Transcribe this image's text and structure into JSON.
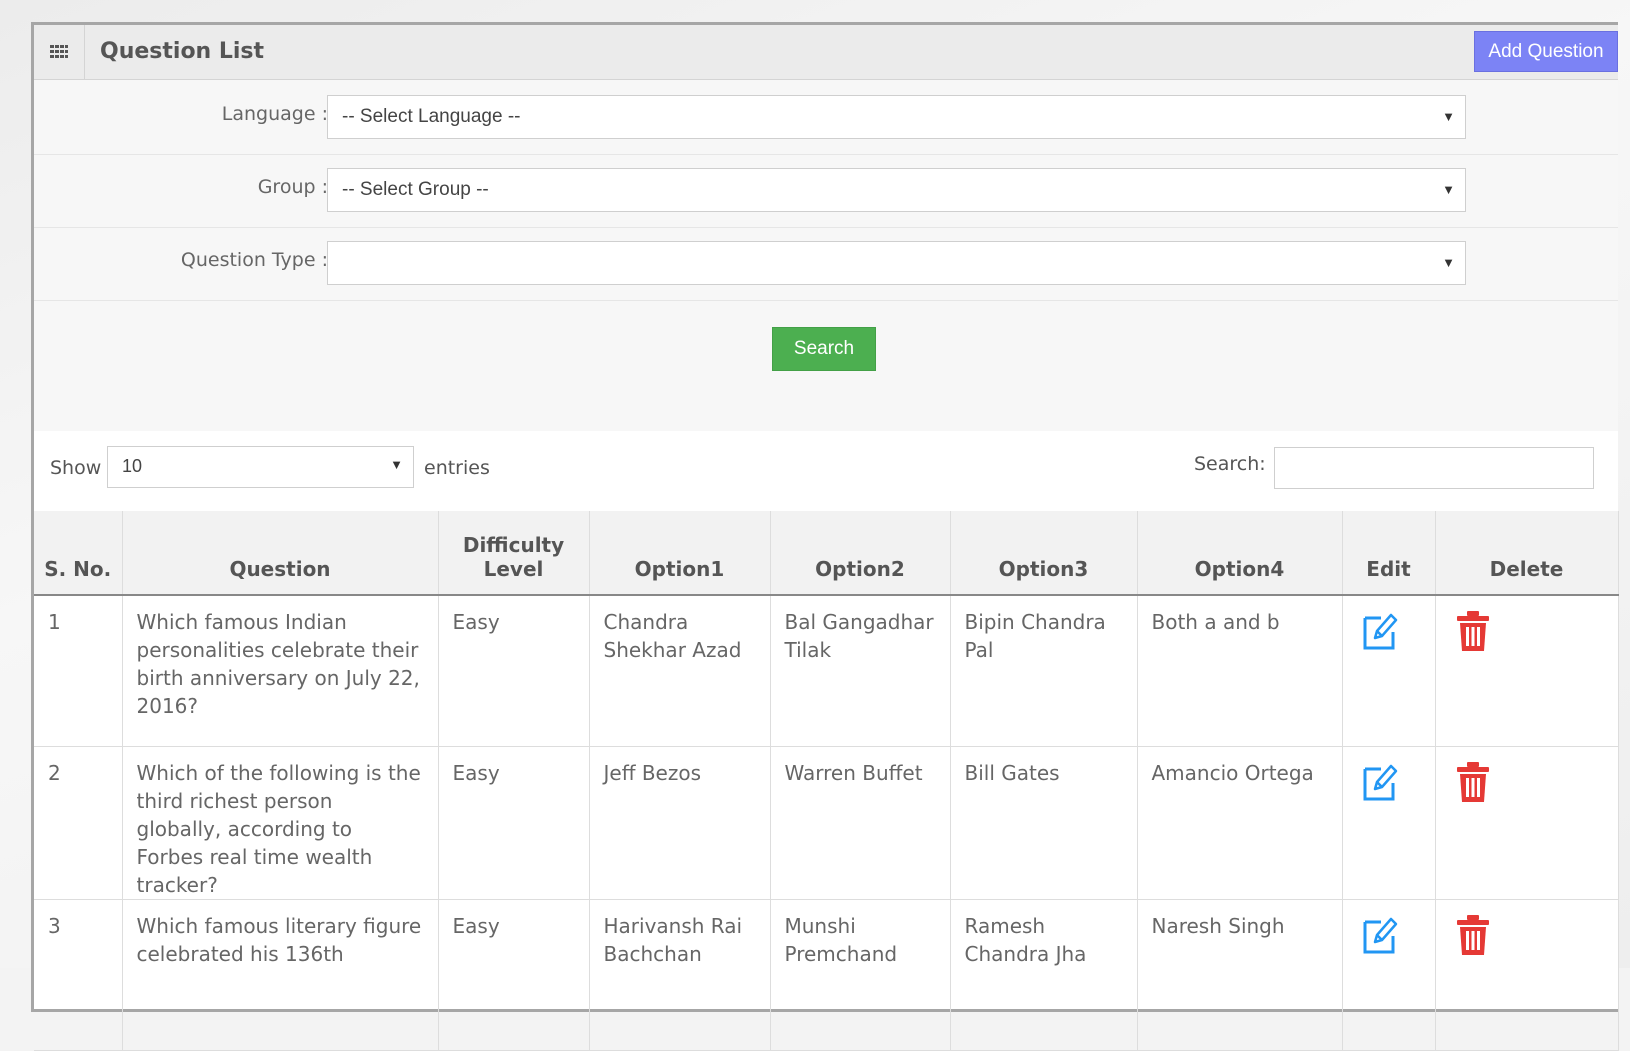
{
  "panel": {
    "title": "Question List",
    "add_button": "Add Question"
  },
  "filters": {
    "language": {
      "label": "Language :",
      "value": "-- Select Language --"
    },
    "group": {
      "label": "Group :",
      "value": "-- Select Group --"
    },
    "question_type": {
      "label": "Question Type :",
      "value": ""
    },
    "search_button": "Search"
  },
  "table_tools": {
    "show_label": "Show",
    "page_length": "10",
    "entries_label": "entries",
    "search_label": "Search:",
    "search_value": ""
  },
  "table": {
    "headers": [
      "S. No.",
      "Question",
      "Difficulty Level",
      "Option1",
      "Option2",
      "Option3",
      "Option4",
      "Edit",
      "Delete"
    ],
    "rows": [
      {
        "sno": "1",
        "question": " Which famous Indian personalities celebrate their birth anniversary on July 22, 2016?",
        "difficulty": "Easy",
        "option1": "Chandra Shekhar Azad",
        "option2": "Bal Gangadhar Tilak",
        "option3": "Bipin Chandra Pal",
        "option4": "Both a and b"
      },
      {
        "sno": "2",
        "question": "Which of the following is the third richest person globally, according to Forbes real time wealth tracker?",
        "difficulty": "Easy",
        "option1": "Jeff Bezos",
        "option2": "Warren Buffet",
        "option3": "Bill Gates",
        "option4": "Amancio Ortega"
      },
      {
        "sno": "3",
        "question": "Which famous literary figure celebrated his 136th",
        "difficulty": "Easy",
        "option1": "Harivansh Rai Bachchan",
        "option2": "Munshi Premchand",
        "option3": "Ramesh Chandra Jha",
        "option4": "Naresh Singh"
      }
    ]
  },
  "colors": {
    "correct": "#43a047",
    "incorrect": "#e53935",
    "add_button": "#7c83f5",
    "search_button": "#4caf50",
    "edit_icon": "#2196f3",
    "delete_icon": "#e53935"
  },
  "icons": {
    "header": "grid-icon",
    "edit": "edit-icon",
    "delete": "trash-icon"
  }
}
